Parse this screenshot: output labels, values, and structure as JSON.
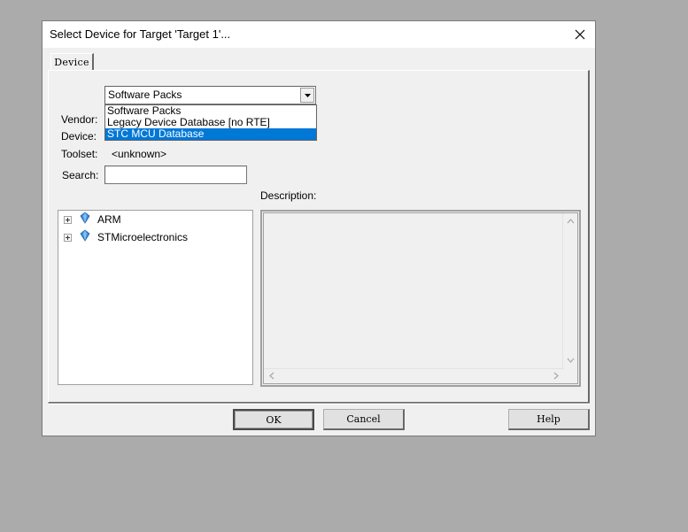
{
  "window": {
    "title": "Select Device for Target 'Target 1'...",
    "close_icon": "close-icon"
  },
  "tabs": [
    {
      "label": "Device"
    }
  ],
  "source_combo": {
    "value": "Software Packs",
    "options": [
      "Software Packs",
      "Legacy Device Database [no RTE]",
      "STC MCU Database"
    ],
    "selected_index": 2
  },
  "fields": {
    "vendor_label": "Vendor:",
    "device_label": "Device:",
    "toolset_label": "Toolset:",
    "toolset_value": "<unknown>",
    "search_label": "Search:",
    "search_value": "",
    "description_label": "Description:"
  },
  "tree": {
    "items": [
      {
        "label": "ARM",
        "icon": "diamond-icon"
      },
      {
        "label": "STMicroelectronics",
        "icon": "diamond-icon"
      }
    ]
  },
  "buttons": {
    "ok": "OK",
    "cancel": "Cancel",
    "help": "Help"
  },
  "colors": {
    "selection": "#0078d7",
    "dialog_bg": "#f0f0f0",
    "desktop_bg": "#ababab"
  }
}
